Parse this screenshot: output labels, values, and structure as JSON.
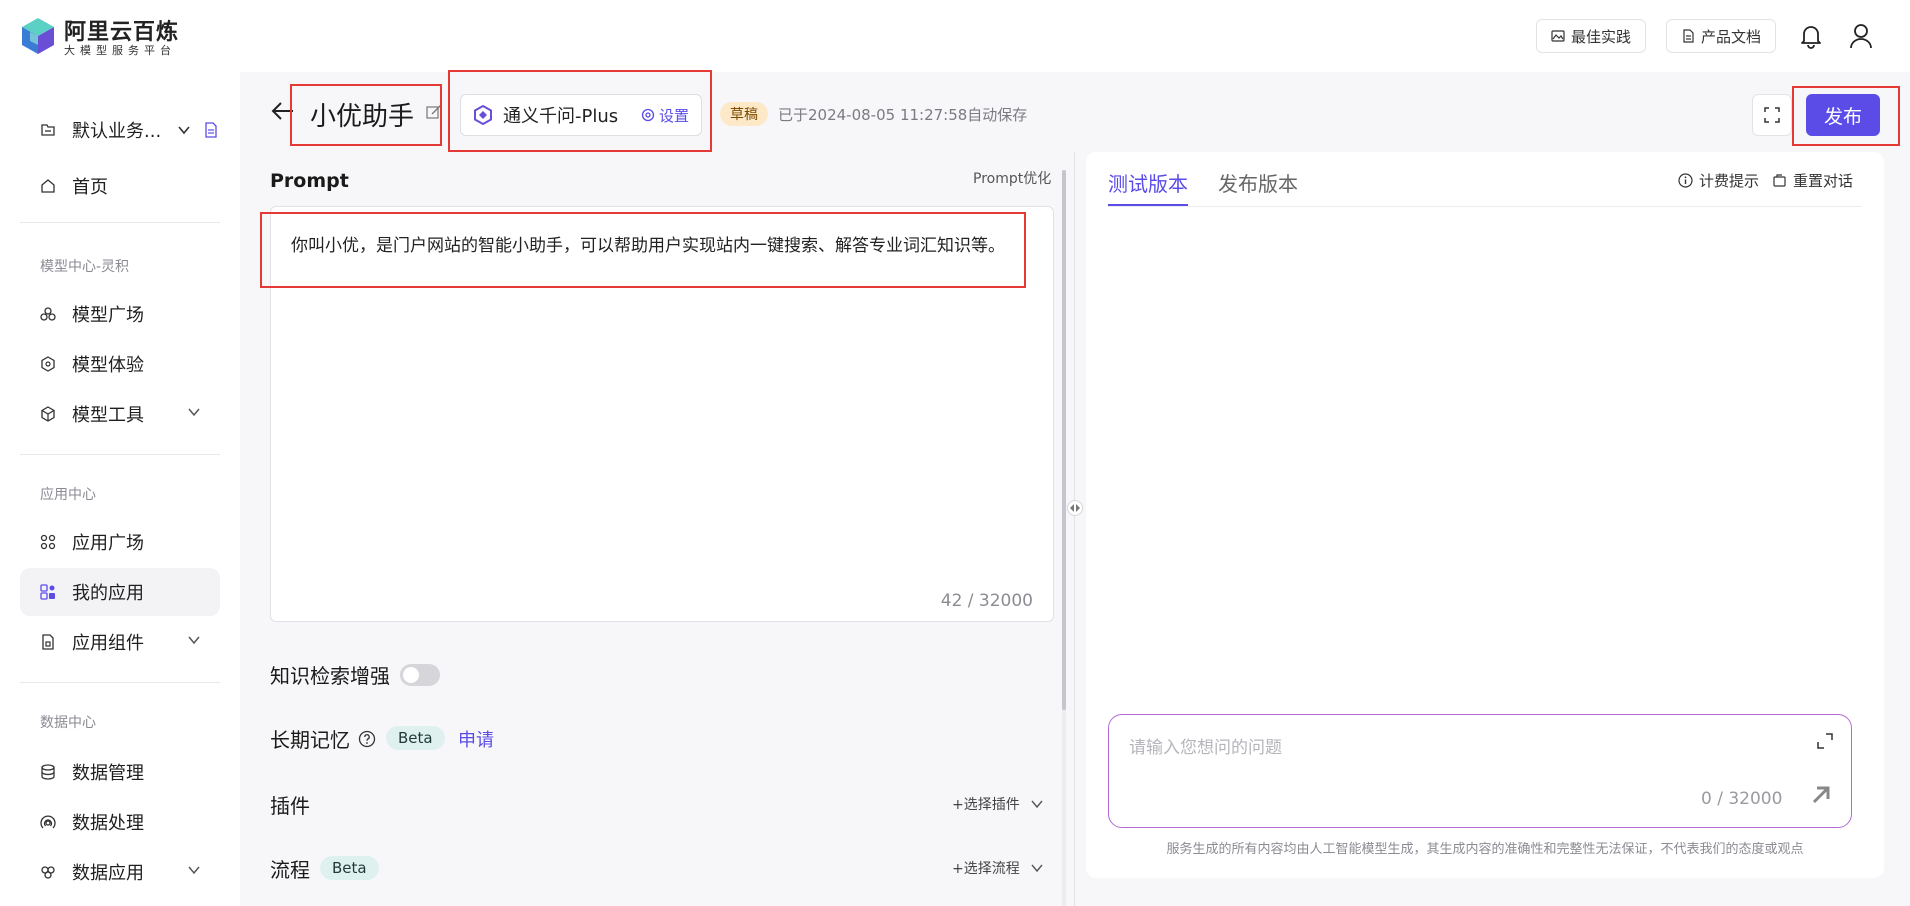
{
  "header": {
    "brand_title": "阿里云百炼",
    "brand_subtitle": "大模型服务平台",
    "best_practice_label": "最佳实践",
    "docs_label": "产品文档"
  },
  "sidebar": {
    "workspace_label": "默认业务...",
    "home_label": "首页",
    "section_model": "模型中心-灵积",
    "model_plaza": "模型广场",
    "model_experience": "模型体验",
    "model_tools": "模型工具",
    "section_app": "应用中心",
    "app_plaza": "应用广场",
    "my_apps": "我的应用",
    "app_components": "应用组件",
    "section_data": "数据中心",
    "data_management": "数据管理",
    "data_processing": "数据处理",
    "data_app": "数据应用"
  },
  "editor": {
    "app_name": "小优助手",
    "model_name": "通义千问-Plus",
    "settings_label": "设置",
    "draft_badge": "草稿",
    "autosave_text": "已于2024-08-05 11:27:58自动保存",
    "publish_label": "发布",
    "prompt_label": "Prompt",
    "prompt_optimize_label": "Prompt优化",
    "prompt_text": "你叫小优，是门户网站的智能小助手，可以帮助用户实现站内一键搜索、解答专业词汇知识等。",
    "prompt_count": "42 / 32000",
    "knowledge_label": "知识检索增强",
    "memory_label": "长期记忆",
    "beta_label": "Beta",
    "apply_label": "申请",
    "plugins_label": "插件",
    "select_plugin_label": "+选择插件",
    "flow_label": "流程",
    "flow_beta_label": "Beta",
    "select_flow_label": "+选择流程"
  },
  "test_panel": {
    "tab_test": "测试版本",
    "tab_published": "发布版本",
    "billing_label": "计费提示",
    "reset_label": "重置对话",
    "input_placeholder": "请输入您想问的问题",
    "input_count": "0 / 32000",
    "disclaimer": "服务生成的所有内容均由人工智能模型生成，其生成内容的准确性和完整性无法保证，不代表我们的态度或观点"
  },
  "colors": {
    "accent": "#5b4ce8",
    "annotation_red": "#e53935",
    "draft_badge_bg": "#fde9c7",
    "beta_badge_bg": "#dff1ef"
  }
}
